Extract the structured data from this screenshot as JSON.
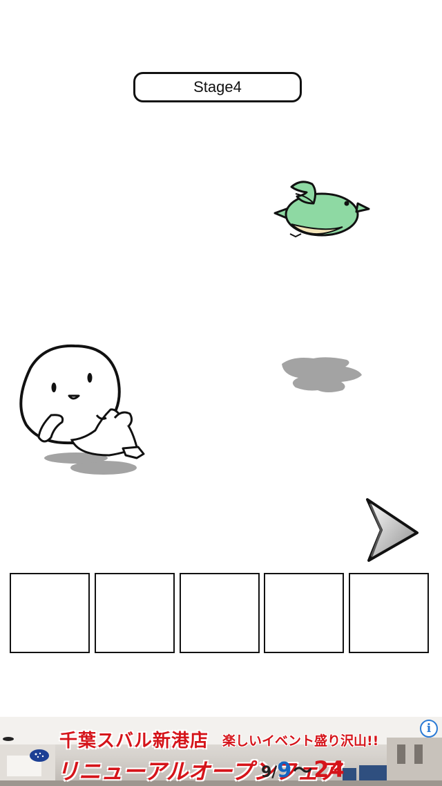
{
  "stage": {
    "label": "Stage4"
  },
  "scene": {
    "character": "round-white-character",
    "bird": "green-bird",
    "arrow": "next-arrow-icon"
  },
  "item_slots": {
    "count": 5
  },
  "ad": {
    "line1": "千葉スバル新港店",
    "tagline": "楽しいイベント盛り沢山!!",
    "line2": "リニューアルオープンフェア",
    "date_month": "9/",
    "date_day1": "9",
    "date_tilde": "〜",
    "date_day2": "24",
    "info_icon": "i"
  },
  "colors": {
    "bird_body": "#8ed9a3",
    "bird_belly": "#f3e4b8",
    "shadow": "#a3a3a3",
    "ad_red": "#d5141a"
  }
}
